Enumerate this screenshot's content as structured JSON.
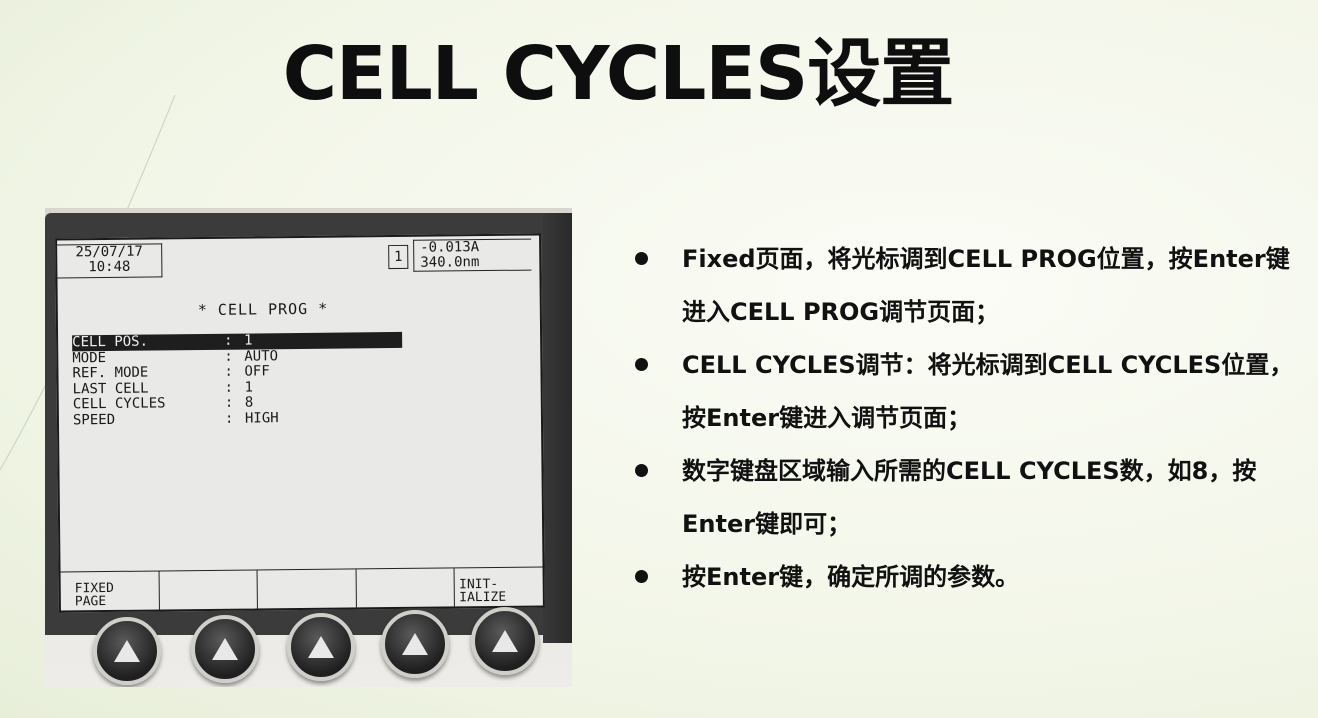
{
  "slide": {
    "title": "CELL CYCLES设置",
    "bullets": [
      "Fixed页面，将光标调到CELL PROG位置，按Enter键进入CELL PROG调节页面；",
      "CELL CYCLES调节：将光标调到CELL CYCLES位置，按Enter键进入调节页面；",
      "数字键盘区域输入所需的CELL CYCLES数，如8，按Enter键即可；",
      "按Enter键，确定所调的参数。"
    ]
  },
  "device_screen": {
    "date": "25/07/17",
    "time": "10:48",
    "page_number": "1",
    "absorbance": "-0.013A",
    "wavelength": "340.0nm",
    "heading": "* CELL PROG *",
    "rows": [
      {
        "label": "CELL POS.",
        "sep": ":",
        "value": "1",
        "selected": true
      },
      {
        "label": "MODE",
        "sep": ":",
        "value": "AUTO"
      },
      {
        "label": "REF. MODE",
        "sep": ":",
        "value": "OFF"
      },
      {
        "label": "LAST CELL",
        "sep": ":",
        "value": "1"
      },
      {
        "label": "CELL CYCLES",
        "sep": ":",
        "value": "8"
      },
      {
        "label": "SPEED",
        "sep": ":",
        "value": "HIGH"
      }
    ],
    "softkeys": [
      "FIXED\nPAGE",
      "",
      "",
      "",
      "INIT-\nIALIZE"
    ]
  },
  "hardware_buttons": [
    "up-arrow-icon",
    "up-arrow-icon",
    "up-arrow-icon",
    "up-arrow-icon",
    "up-arrow-icon"
  ]
}
